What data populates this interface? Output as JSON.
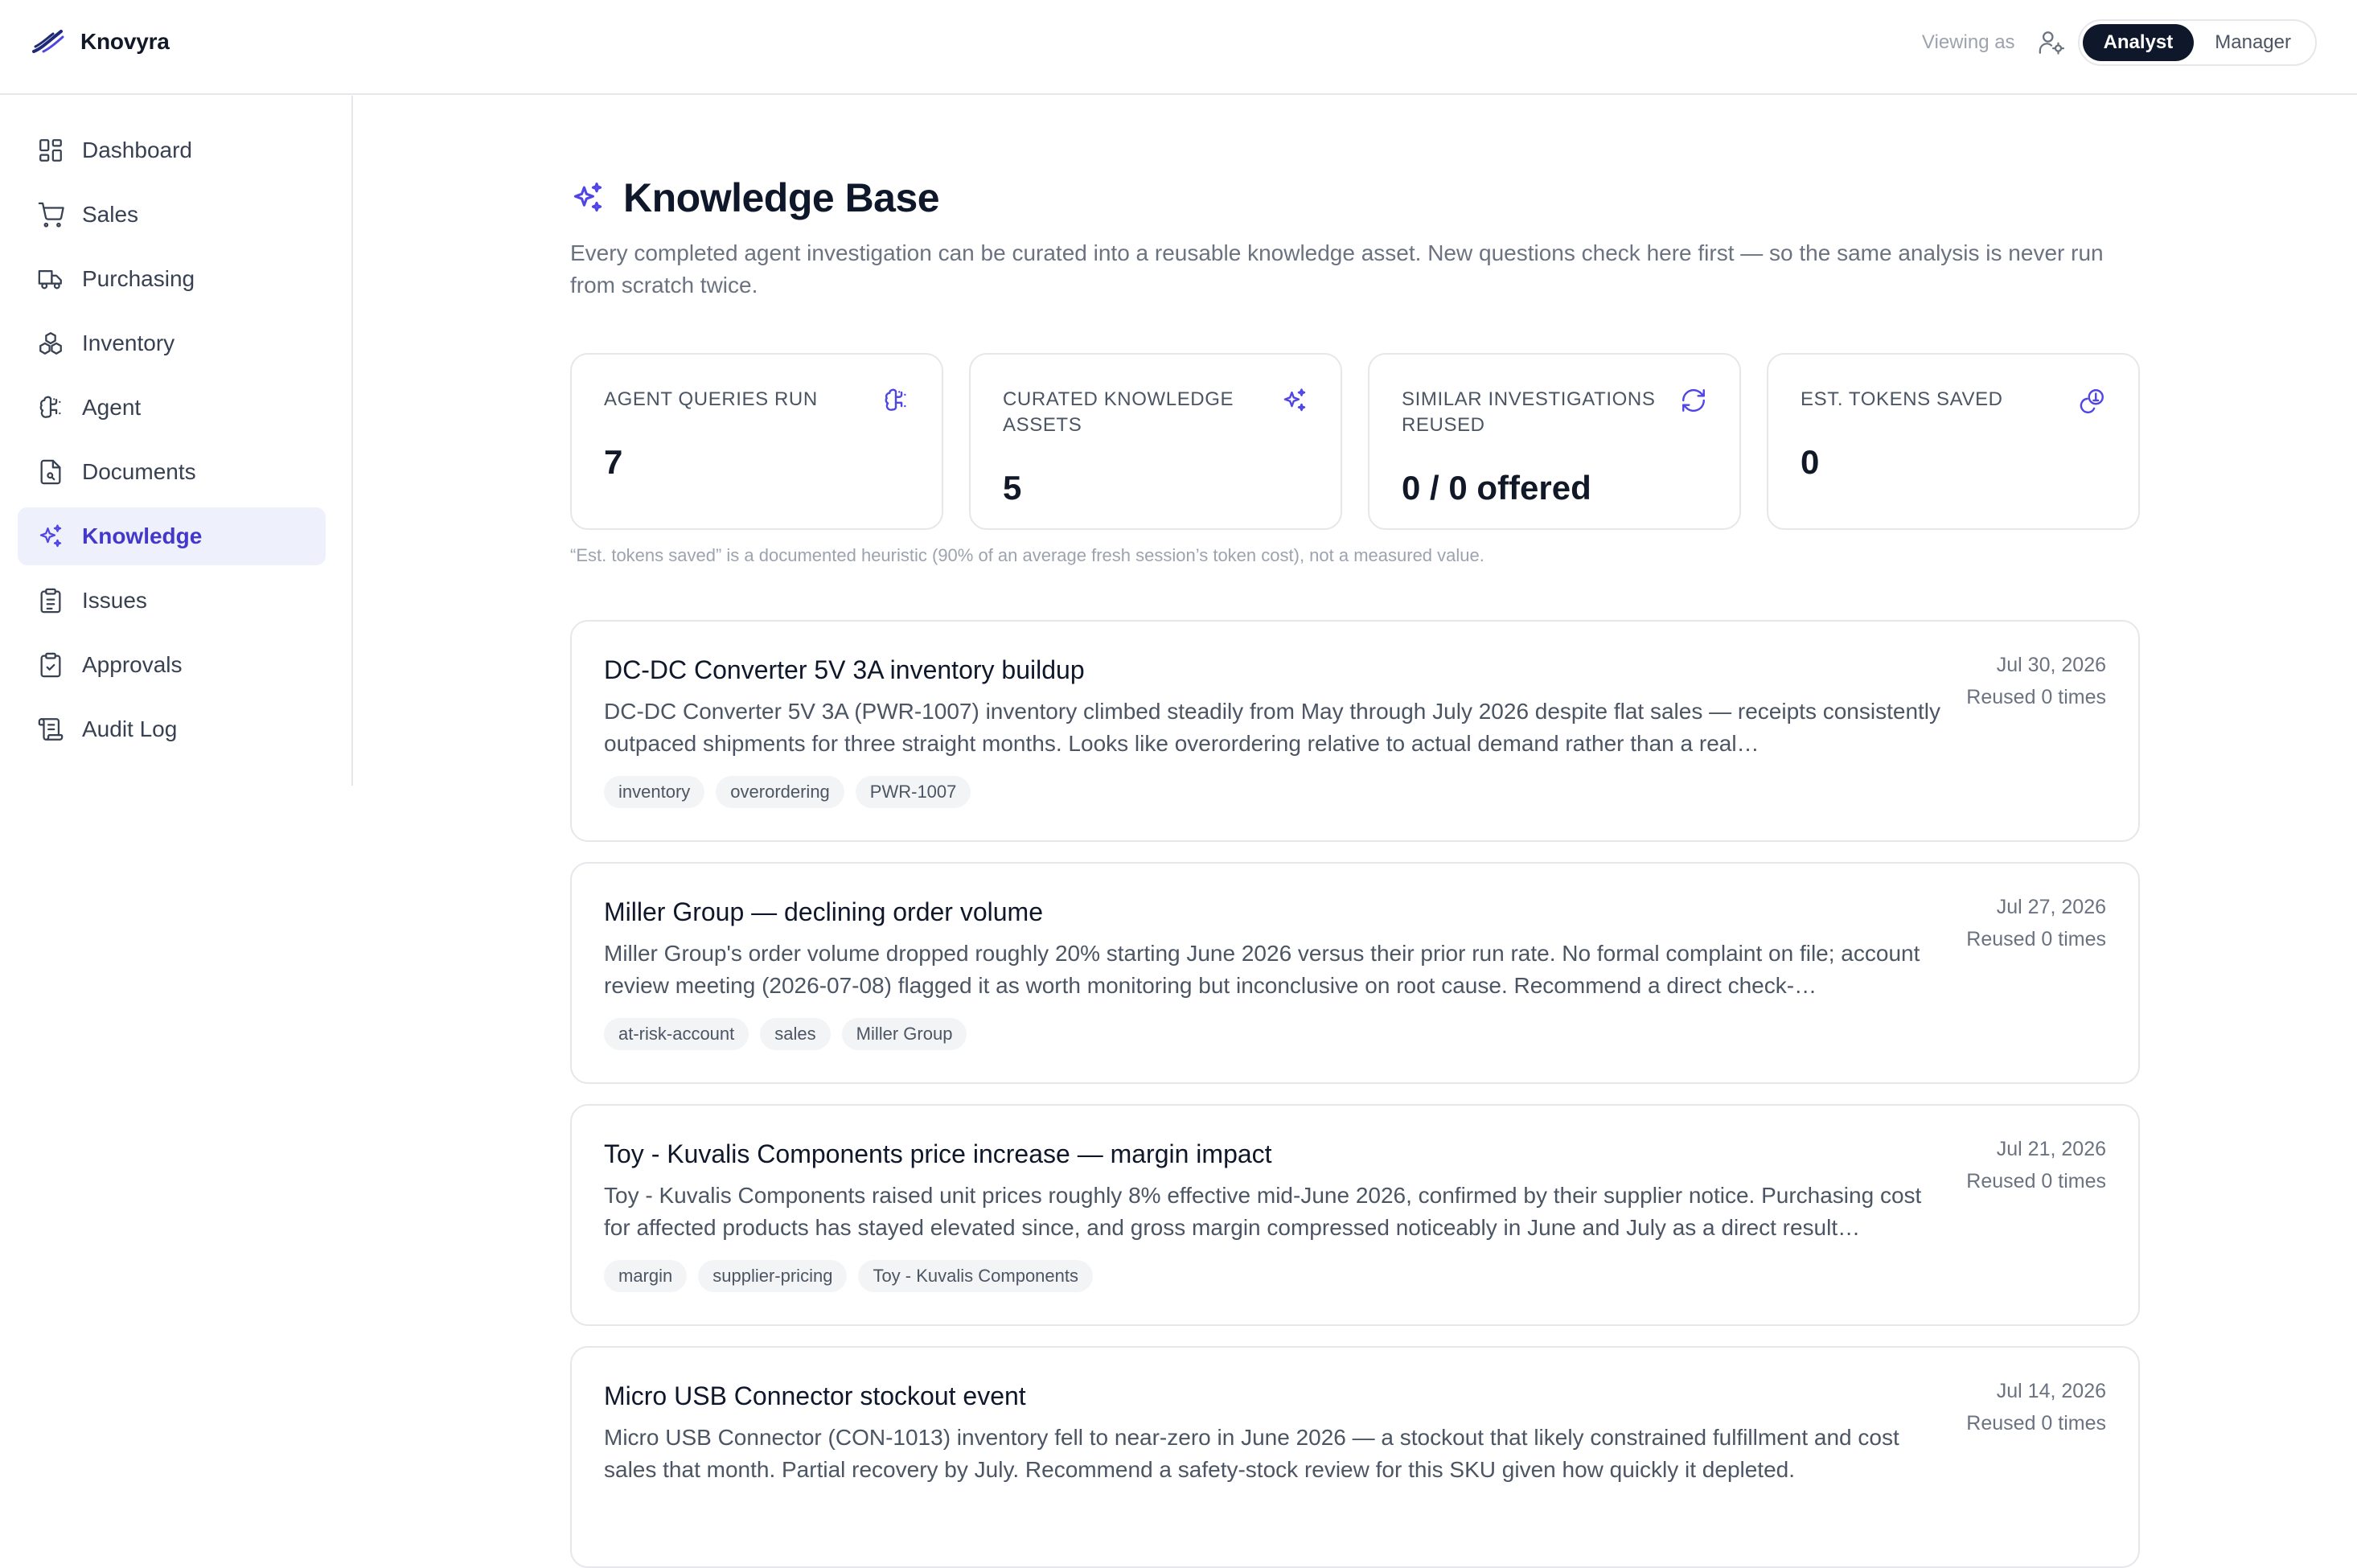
{
  "app": {
    "brand_name": "Knovyra",
    "viewing_label": "Viewing as",
    "roles": [
      "Analyst",
      "Manager"
    ],
    "active_role": "Analyst",
    "accent_color": "#4f46e5"
  },
  "sidebar": {
    "items": [
      {
        "label": "Dashboard",
        "icon": "dashboard-icon"
      },
      {
        "label": "Sales",
        "icon": "cart-icon"
      },
      {
        "label": "Purchasing",
        "icon": "truck-icon"
      },
      {
        "label": "Inventory",
        "icon": "boxes-icon"
      },
      {
        "label": "Agent",
        "icon": "brain-icon"
      },
      {
        "label": "Documents",
        "icon": "document-icon"
      },
      {
        "label": "Knowledge",
        "icon": "sparkles-icon",
        "active": true
      },
      {
        "label": "Issues",
        "icon": "clipboard-list-icon"
      },
      {
        "label": "Approvals",
        "icon": "clipboard-check-icon"
      },
      {
        "label": "Audit Log",
        "icon": "scroll-icon"
      }
    ]
  },
  "page": {
    "title": "Knowledge Base",
    "description": "Every completed agent investigation can be curated into a reusable knowledge asset. New questions check here first — so the same analysis is never run from scratch twice."
  },
  "stats": [
    {
      "label": "AGENT QUERIES RUN",
      "value": "7",
      "icon": "brain-icon"
    },
    {
      "label": "CURATED KNOWLEDGE ASSETS",
      "value": "5",
      "icon": "sparkles-icon"
    },
    {
      "label": "SIMILAR INVESTIGATIONS REUSED",
      "value": "0 / 0 offered",
      "icon": "refresh-icon"
    },
    {
      "label": "EST. TOKENS SAVED",
      "value": "0",
      "icon": "coins-icon"
    }
  ],
  "footnote": "“Est. tokens saved” is a documented heuristic (90% of an average fresh session’s token cost), not a measured value.",
  "assets": [
    {
      "title": "DC-DC Converter 5V 3A inventory buildup",
      "summary": "DC-DC Converter 5V 3A (PWR-1007) inventory climbed steadily from May through July 2026 despite flat sales — receipts consistently outpaced shipments for three straight months. Looks like overordering relative to actual demand rather than a real…",
      "date": "Jul 30, 2026",
      "reuse": "Reused 0 times",
      "tags": [
        "inventory",
        "overordering",
        "PWR-1007"
      ]
    },
    {
      "title": "Miller Group — declining order volume",
      "summary": "Miller Group's order volume dropped roughly 20% starting June 2026 versus their prior run rate. No formal complaint on file; account review meeting (2026-07-08) flagged it as worth monitoring but inconclusive on root cause. Recommend a direct check-…",
      "date": "Jul 27, 2026",
      "reuse": "Reused 0 times",
      "tags": [
        "at-risk-account",
        "sales",
        "Miller Group"
      ]
    },
    {
      "title": "Toy - Kuvalis Components price increase — margin impact",
      "summary": "Toy - Kuvalis Components raised unit prices roughly 8% effective mid-June 2026, confirmed by their supplier notice. Purchasing cost for affected products has stayed elevated since, and gross margin compressed noticeably in June and July as a direct result…",
      "date": "Jul 21, 2026",
      "reuse": "Reused 0 times",
      "tags": [
        "margin",
        "supplier-pricing",
        "Toy - Kuvalis Components"
      ]
    },
    {
      "title": "Micro USB Connector stockout event",
      "summary": "Micro USB Connector (CON-1013) inventory fell to near-zero in June 2026 — a stockout that likely constrained fulfillment and cost sales that month. Partial recovery by July. Recommend a safety-stock review for this SKU given how quickly it depleted.",
      "date": "Jul 14, 2026",
      "reuse": "Reused 0 times",
      "tags": []
    }
  ]
}
